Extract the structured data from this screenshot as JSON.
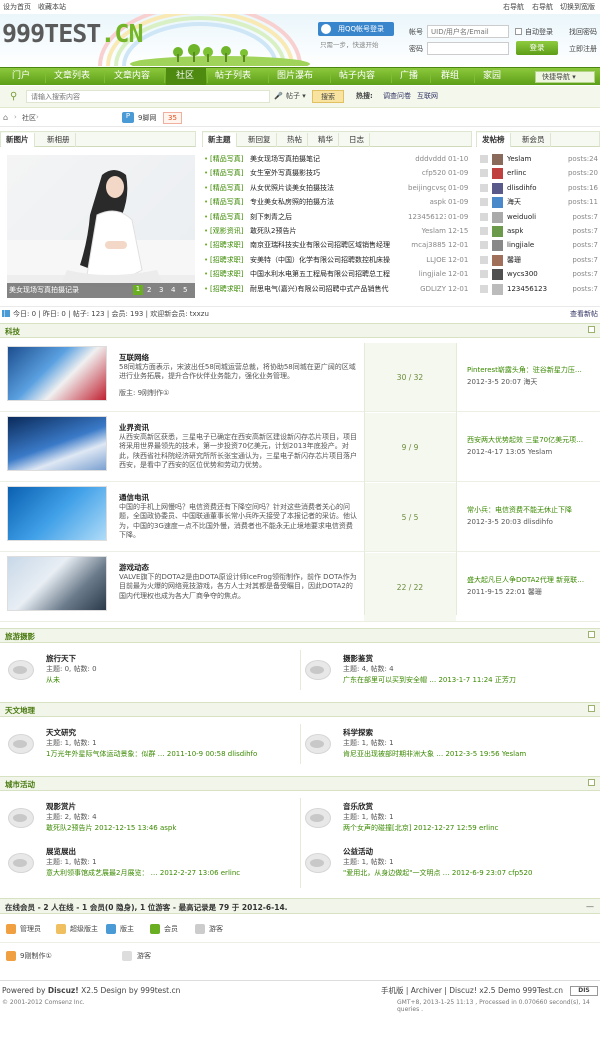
{
  "topbar": {
    "home": "设为首页",
    "fav": "收藏本站",
    "right_nav": "右导航",
    "right_nav2": "右导航",
    "style": "切换到宽版"
  },
  "logo": {
    "main": "999TEST",
    "cn": ".CN"
  },
  "login": {
    "qq_btn": "用QQ帐号登录",
    "qq_tip": "只需一步，快速开始",
    "account_label": "帐号",
    "account_ph": "UID/用户名/Email",
    "auto_login": "自动登录",
    "find_pwd": "找回密码",
    "pwd_label": "密码",
    "login_btn": "登录",
    "register": "立即注册"
  },
  "nav": {
    "items": [
      "门户",
      "文章列表",
      "文章内容",
      "社区",
      "帖子列表",
      "图片瀑布",
      "帖子内容",
      "广播",
      "群组",
      "家园"
    ],
    "quick": "快捷导航"
  },
  "search": {
    "placeholder": "请输入搜索内容",
    "type": "帖子",
    "btn": "搜索",
    "hot_label": "热搜:",
    "hot": [
      "调查问卷",
      "互联网"
    ]
  },
  "crumb": {
    "home_icon": "home-icon",
    "section": "社区",
    "site": "9脚网",
    "count": "35"
  },
  "gallery": {
    "tabs": [
      "新图片",
      "新相册"
    ],
    "caption": "美女现场写真拍摄记录",
    "pages": [
      "1",
      "2",
      "3",
      "4",
      "5"
    ]
  },
  "threads": {
    "tabs": [
      "新主题",
      "新回复",
      "热帖",
      "精华",
      "日志"
    ],
    "items": [
      {
        "tag": "[精品写真]",
        "title": "美女现场写真拍摄笔记",
        "user": "dddvddd",
        "date": "01-10"
      },
      {
        "tag": "[精品写真]",
        "title": "女生室外写真摄影技巧",
        "user": "cfp520",
        "date": "01-09"
      },
      {
        "tag": "[精品写真]",
        "title": "从女优照片谈美女拍摄技法",
        "user": "beijingcvsg",
        "date": "01-09"
      },
      {
        "tag": "[精品写真]",
        "title": "专业美女私房照的拍摄方法",
        "user": "aspk",
        "date": "01-09"
      },
      {
        "tag": "[精品写真]",
        "title": "刻下刺青之后",
        "user": "123456123",
        "date": "01-09"
      },
      {
        "tag": "[观影资讯]",
        "title": "敢死队2预告片",
        "user": "Yeslam",
        "date": "12-15"
      },
      {
        "tag": "[招聘求职]",
        "title": "南京亚瑞科技实业有限公司招聘区域销售经理",
        "user": "mcaj3885",
        "date": "12-01"
      },
      {
        "tag": "[招聘求职]",
        "title": "安美特（中国）化学有限公司招聘数控机床操",
        "user": "LLJOE",
        "date": "12-01"
      },
      {
        "tag": "[招聘求职]",
        "title": "中国水利水电第五工程局有限公司招聘总工程",
        "user": "lingjiale",
        "date": "12-01"
      },
      {
        "tag": "[招聘求职]",
        "title": "耐思电气(嘉兴)有限公司招聘中式产品销售代",
        "user": "GDLIZY",
        "date": "12-01"
      }
    ]
  },
  "ranking": {
    "tabs": [
      "发帖榜",
      "新会员"
    ],
    "items": [
      {
        "user": "Yeslam",
        "posts": "posts:24"
      },
      {
        "user": "erlinc",
        "posts": "posts:20"
      },
      {
        "user": "dlisdihfo",
        "posts": "posts:16"
      },
      {
        "user": "海天",
        "posts": "posts:11"
      },
      {
        "user": "weiduoli",
        "posts": "posts:7"
      },
      {
        "user": "aspk",
        "posts": "posts:7"
      },
      {
        "user": "lingjiale",
        "posts": "posts:7"
      },
      {
        "user": "馨珊",
        "posts": "posts:7"
      },
      {
        "user": "wycs300",
        "posts": "posts:7"
      },
      {
        "user": "123456123",
        "posts": "posts:7"
      }
    ]
  },
  "stats": {
    "text": "今日: 0 | 昨日: 0 | 帖子: 123 | 会员: 193 | 欢迎新会员: txxzu",
    "new_link": "查看新帖"
  },
  "tech": {
    "title": "科技",
    "forums": [
      {
        "name": "互联网络",
        "desc": "58同城方面表示，宋波出任58同城运营总裁，将协助58同城在更广阔的区域进行业务拓展，提升合作伙伴业务能力，强化业务管理。",
        "mod": "版主: 9刚制作①",
        "count": "30 / 32",
        "last": "Pinterest崭露头角：驻谷新星力压…",
        "last_time": "2012-3-5 20:07 海天"
      },
      {
        "name": "业界资讯",
        "desc": "从西安高新区获悉，三星电子已确定在西安高新区建设新闪存芯片项目，项目将采用世界最领先的技术，第一步投资70亿美元，计划2013年底投产。对此，陕西省社科院经济研究所所长张宝通认为，三星电子新闪存芯片项目落户西安，是看中了西安的区位优势和劳动力优势。",
        "mod": "",
        "count": "9 / 9",
        "last": "西安两大优势起效 三星70亿美元项…",
        "last_time": "2012-4-17 13:05 Yeslam"
      },
      {
        "name": "通信电讯",
        "desc": "中国的手机上网慢吗？电信资费还有下降空间吗？针对这些消费者关心的问题，全国政协委员、中国联通董事长常小兵昨天接受了本报记者的采访。他认为，中国的3G速度一点不比国外慢，消费者也不能永无止境地要求电信资费下降。",
        "mod": "",
        "count": "5 / 5",
        "last": "常小兵：电信资费不能无休止下降",
        "last_time": "2012-3-5 20:03 dlisdihfo"
      },
      {
        "name": "游戏动态",
        "desc": "VALVE旗下的DOTA2是由DOTA原设计师IceFrog领衔制作，前作 DOTA作为目前最为火爆的网络竞技游戏，各方人士对其都是备受瞩目，因此DOTA2的国内代理权也成为各大厂商争夺的焦点。",
        "mod": "",
        "count": "22 / 22",
        "last": "盛大起凡巨人争DOTA2代理 新竞联…",
        "last_time": "2011-9-15 22:01 馨珊"
      }
    ]
  },
  "travel": {
    "title": "旅游摄影",
    "forums": [
      {
        "name": "旅行天下",
        "stats": "主题: 0, 帖数: 0",
        "last": "从未"
      },
      {
        "name": "摄影鉴赏",
        "stats": "主题: 4, 帖数: 4",
        "last": "广东在部里可以买到安全帽 … 2013-1-7 11:24 正芳刀"
      }
    ]
  },
  "geo": {
    "title": "天文地理",
    "forums": [
      {
        "name": "天文研究",
        "stats": "主题: 1, 帖数: 1",
        "last": "1万光年外星际气体运动景象：似群 … 2011-10-9 00:58 dlisdihfo"
      },
      {
        "name": "科学探索",
        "stats": "主题: 1, 帖数: 1",
        "last": "肯尼亚出现被部时期非洲大象 … 2012-3-5 19:56 Yeslam"
      }
    ]
  },
  "city": {
    "title": "城市活动",
    "forums": [
      {
        "name": "观影赏片",
        "stats": "主题: 2, 帖数: 4",
        "last": "敢死队2预告片 2012-12-15 13:46 aspk"
      },
      {
        "name": "音乐欣赏",
        "stats": "主题: 1, 帖数: 1",
        "last": "两个女声的碰撞[北京] 2012-12-27 12:59 erlinc"
      },
      {
        "name": "展览展出",
        "stats": "主题: 1, 帖数: 1",
        "last": "意大利领事馆成艺展最2月展览： … 2012-2-27 13:06 erlinc"
      },
      {
        "name": "公益活动",
        "stats": "主题: 1, 帖数: 1",
        "last": "\"爱用北，从身边做起\"一文明点 … 2012-6-9 23:07 cfp520"
      }
    ]
  },
  "online": {
    "title": "在线会员 - 2 人在线 - 1 会员(0 隐身), 1 位游客 - 最高记录是 79 于 2012-6-14.",
    "legend": [
      "管理员",
      "超级版主",
      "版主",
      "会员",
      "游客"
    ],
    "users": [
      "9刚制作①",
      "游客"
    ]
  },
  "footer": {
    "powered": "Powered by ",
    "brand": "Discuz!",
    "ver": " X2.5 Design by 999test.cn",
    "copy": "© 2001-2012 Comsenz Inc.",
    "links": "手机版 | Archiver | Discuz! x2.5 Demo 999Test.cn",
    "info": "GMT+8, 2013-1-25 11:13 , Processed in 0.070660 second(s), 14 queries ."
  }
}
